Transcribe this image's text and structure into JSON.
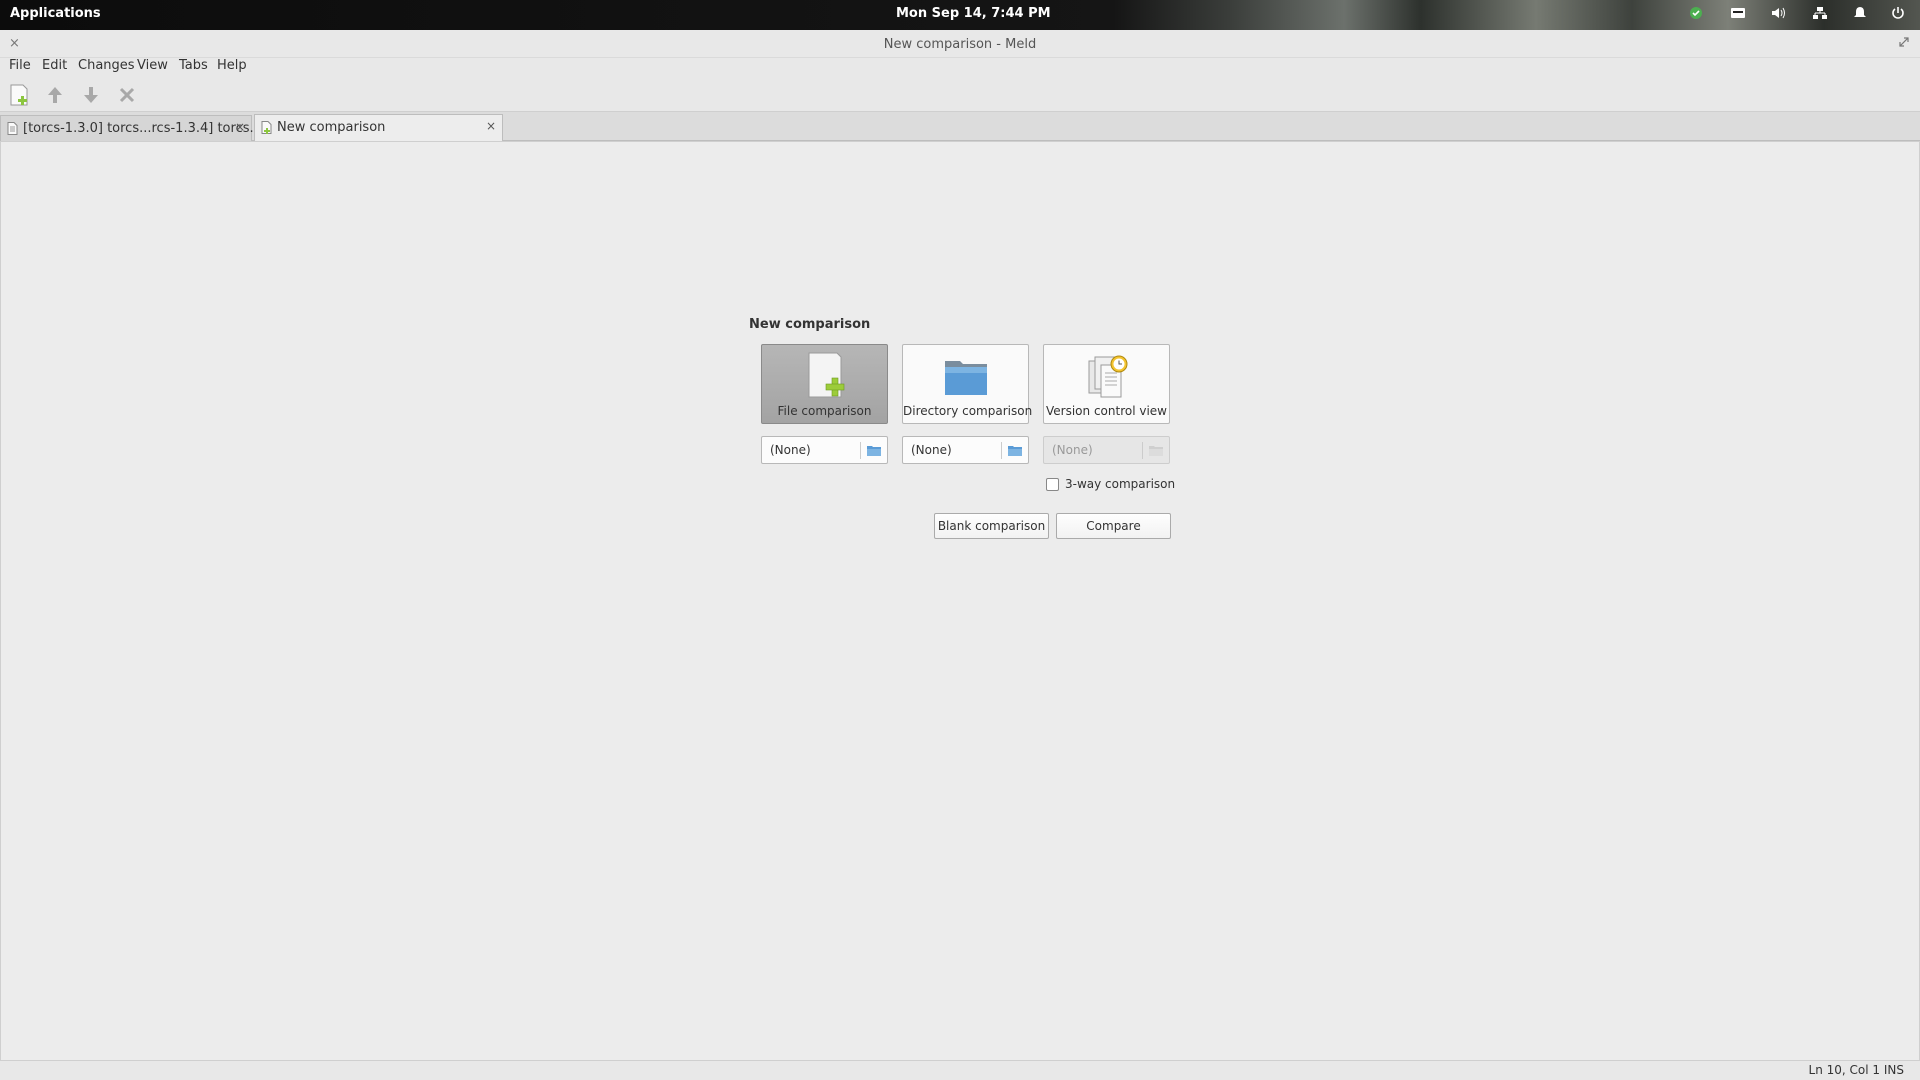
{
  "system_panel": {
    "applications": "Applications",
    "clock": "Mon Sep 14,  7:44 PM",
    "tray_icons": [
      "chat-icon",
      "keyboard-icon",
      "volume-icon",
      "network-icon",
      "notifications-icon",
      "power-icon"
    ]
  },
  "window": {
    "title": "New comparison - Meld",
    "close_glyph": "×"
  },
  "menu": [
    "File",
    "Edit",
    "Changes",
    "View",
    "Tabs",
    "Help"
  ],
  "toolbar": {
    "buttons": [
      "new-comparison-icon",
      "previous-change-icon",
      "next-change-icon",
      "stop-icon"
    ]
  },
  "tabs": [
    {
      "label": "[torcs-1.3.0] torcs...rcs-1.3.4] torcs.in",
      "close": "×",
      "active": false
    },
    {
      "label": "New comparison",
      "close": "×",
      "active": true
    }
  ],
  "new_comparison": {
    "title": "New comparison",
    "modes": [
      {
        "label": "File comparison",
        "icon": "new-file-icon",
        "selected": true
      },
      {
        "label": "Directory comparison",
        "icon": "folder-icon",
        "selected": false
      },
      {
        "label": "Version control view",
        "icon": "version-control-icon",
        "selected": false
      }
    ],
    "choosers": [
      {
        "value": "(None)",
        "enabled": true
      },
      {
        "value": "(None)",
        "enabled": true
      },
      {
        "value": "(None)",
        "enabled": false
      }
    ],
    "three_way": {
      "label": "3-way comparison",
      "checked": false
    },
    "blank_button": "Blank comparison",
    "compare_button": "Compare"
  },
  "status": {
    "text": "Ln 10, Col 1  INS"
  },
  "colors": {
    "background": "#ececec",
    "selected_mode": "#a8a8a8",
    "accent_green": "#8cc63f",
    "folder_blue": "#5a9bd6"
  }
}
